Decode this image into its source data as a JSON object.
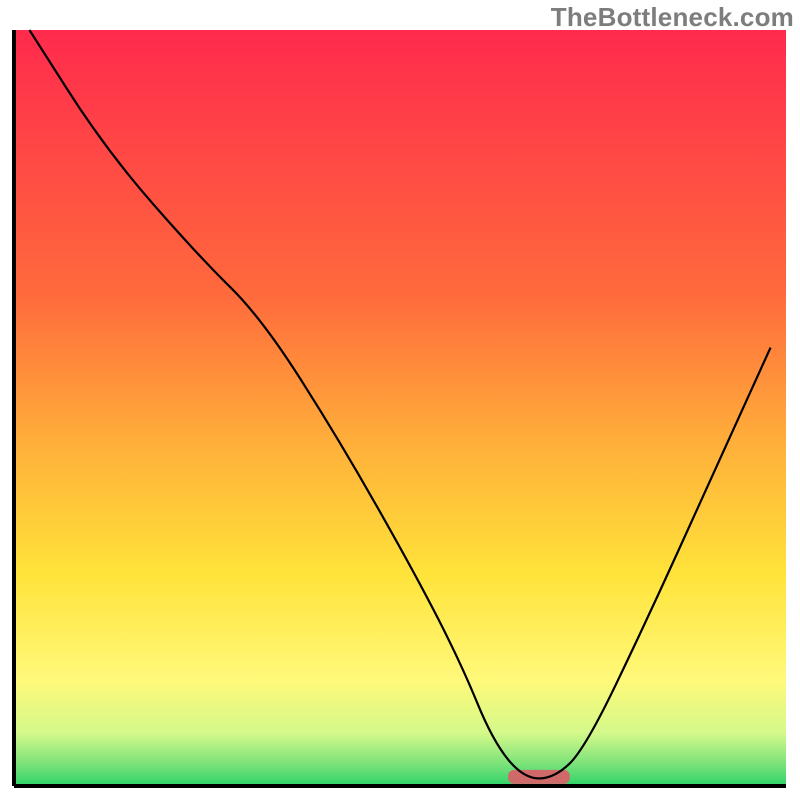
{
  "watermark": "TheBottleneck.com",
  "chart_data": {
    "type": "line",
    "title": "",
    "xlabel": "",
    "ylabel": "",
    "xlim": [
      0,
      100
    ],
    "ylim": [
      0,
      100
    ],
    "grid": false,
    "legend": false,
    "gradient_stops": [
      {
        "offset": 0,
        "color": "#ff2a4d"
      },
      {
        "offset": 35,
        "color": "#ff6a3c"
      },
      {
        "offset": 55,
        "color": "#ffb03a"
      },
      {
        "offset": 72,
        "color": "#ffe33a"
      },
      {
        "offset": 86,
        "color": "#fff97a"
      },
      {
        "offset": 93,
        "color": "#d4f98a"
      },
      {
        "offset": 97,
        "color": "#7de37a"
      },
      {
        "offset": 100,
        "color": "#2dd36a"
      }
    ],
    "series": [
      {
        "name": "bottleneck-curve",
        "color": "#000000",
        "x": [
          2,
          12,
          24,
          32,
          42,
          52,
          58,
          62,
          66,
          70,
          74,
          82,
          90,
          98
        ],
        "values": [
          100,
          84,
          70,
          62,
          46,
          28,
          16,
          6,
          1,
          1,
          5,
          22,
          40,
          58
        ]
      }
    ],
    "marker": {
      "name": "flat-zone-pill",
      "x_start": 64,
      "x_end": 72,
      "y": 1.2,
      "color": "#d06a6a"
    }
  }
}
